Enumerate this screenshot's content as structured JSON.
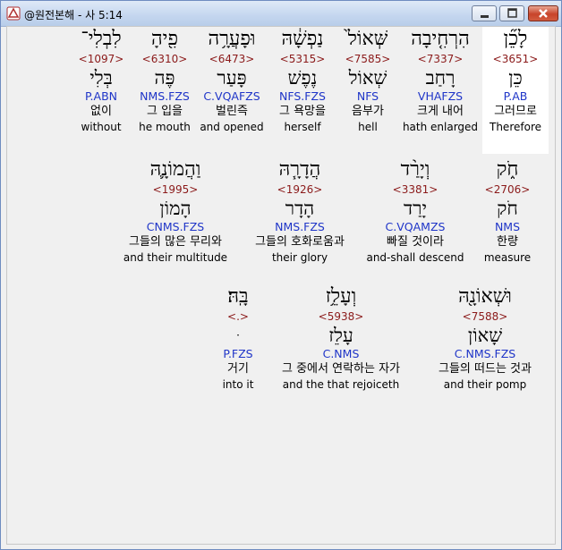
{
  "window": {
    "title": "@원전본해 - 사 5:14"
  },
  "rows": [
    {
      "words": [
        {
          "heb": "לָכֵ֞ן",
          "num": "<3651>",
          "lemma": "כֵּן",
          "pars": "P.AB",
          "kor": "그러므로",
          "eng": "Therefore",
          "selected": true
        },
        {
          "heb": "הִרְחִ֤יבָה",
          "num": "<7337>",
          "lemma": "רָחַב",
          "pars": "VHAFZS",
          "kor": "크게 내어",
          "eng": "hath enlarged"
        },
        {
          "heb": "שְּׁאוֹל֙",
          "num": "<7585>",
          "lemma": "שְׁאוֹל",
          "pars": "NFS",
          "kor": "음부가",
          "eng": "hell"
        },
        {
          "heb": "נַפְשָׁ֔הּ",
          "num": "<5315>",
          "lemma": "נֶפֶשׁ",
          "pars": "NFS.FZS",
          "kor": "그 욕망을",
          "eng": "herself"
        },
        {
          "heb": "וּפָעֲרָ֥ה",
          "num": "<6473>",
          "lemma": "פָּעַר",
          "pars": "C.VQAFZS",
          "kor": "벌린즉",
          "eng": "and opened"
        },
        {
          "heb": "פִ֖יהָ",
          "num": "<6310>",
          "lemma": "פֶּה",
          "pars": "NMS.FZS",
          "kor": "그 입을",
          "eng": "he mouth"
        },
        {
          "heb": "לִבְלִי־",
          "num": "<1097>",
          "lemma": "בְּלִי",
          "pars": "P.ABN",
          "kor": "없이",
          "eng": "without"
        }
      ]
    },
    {
      "words": [
        {
          "heb": "חֹ֑ק",
          "num": "<2706>",
          "lemma": "חֹק",
          "pars": "NMS",
          "kor": "한량",
          "eng": "measure"
        },
        {
          "heb": "וְיָרַ֨ד",
          "num": "<3381>",
          "lemma": "יָרַד",
          "pars": "C.VQAMZS",
          "kor": "빠질 것이라",
          "eng": "and-shall descend"
        },
        {
          "heb": "הֲדָרָ֧הּ",
          "num": "<1926>",
          "lemma": "הָדָר",
          "pars": "NMS.FZS",
          "kor": "그들의 호화로움과",
          "eng": "their glory"
        },
        {
          "heb": "וַהֲמוֹנָ֛הּ",
          "num": "<1995>",
          "lemma": "הָמוֹן",
          "pars": "CNMS.FZS",
          "kor": "그들의 많은 무리와",
          "eng": "and their multitude"
        }
      ]
    },
    {
      "words": [
        {
          "heb": "וּשְׁאוֹנָ֖הּ",
          "num": "<7588>",
          "lemma": "שָׁאוֹן",
          "pars": "C.NMS.FZS",
          "kor": "그들의 떠드는 것과",
          "eng": "and their pomp"
        },
        {
          "heb": "וְעָלֵ֥ז",
          "num": "<5938>",
          "lemma": "עָלֵז",
          "pars": "C.NMS",
          "kor": "그 중에서 연락하는 자가",
          "eng": "and the that rejoiceth"
        },
        {
          "heb": "בָּֽהּ׃",
          "num": "<.>",
          "lemma": "ּ",
          "pars": "P.FZS",
          "kor": "거기",
          "eng": "into it"
        }
      ]
    }
  ]
}
